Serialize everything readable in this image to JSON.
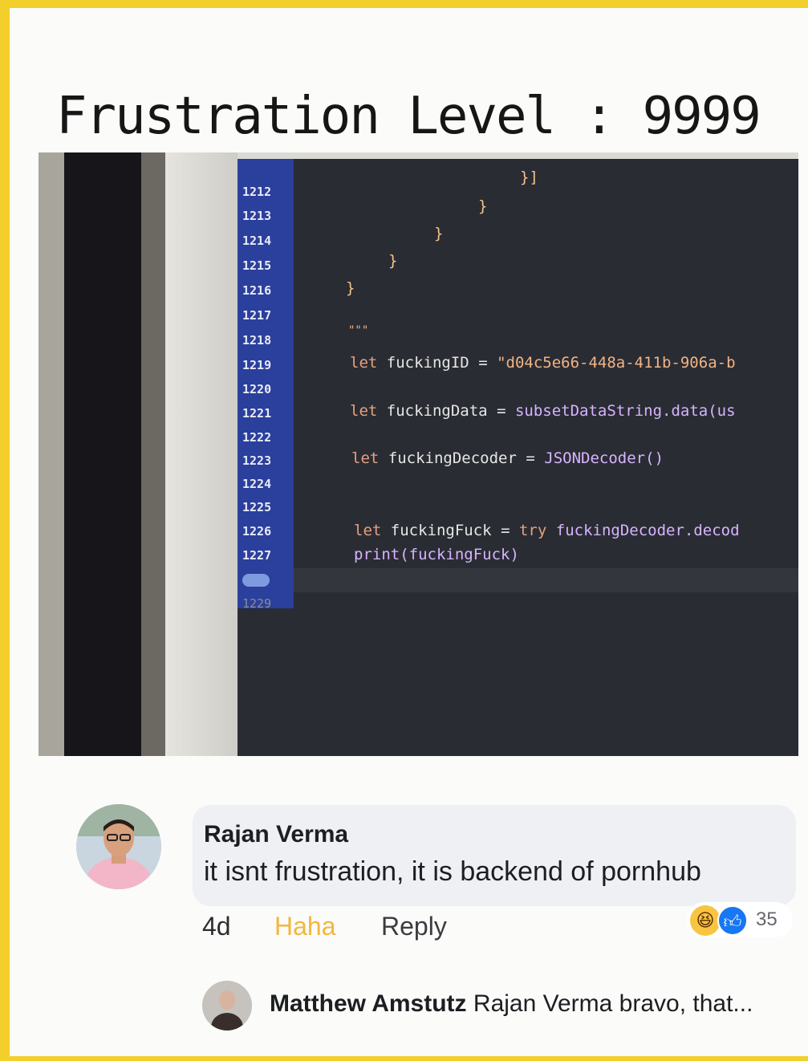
{
  "heading": "Frustration Level : 9999",
  "code_photo": {
    "line_numbers": [
      "1212",
      "1213",
      "1214",
      "1215",
      "1216",
      "1217",
      "1218",
      "1219",
      "1220",
      "1221",
      "1222",
      "1223",
      "1224",
      "1225",
      "1226",
      "1227",
      "1229"
    ],
    "braces": [
      "}]",
      "}",
      "}",
      "}",
      "}"
    ],
    "marker": "\"\"\"",
    "lines": {
      "l1219": {
        "kw": "let",
        "name": "fuckingID",
        "eq": "=",
        "value": "\"d04c5e66-448a-411b-906a-b"
      },
      "l1221": {
        "kw": "let",
        "name": "fuckingData",
        "eq": "=",
        "value": "subsetDataString.data(us"
      },
      "l1223": {
        "kw": "let",
        "name": "fuckingDecoder",
        "eq": "=",
        "value": "JSONDecoder()"
      },
      "l1226": {
        "kw": "let",
        "name": "fuckingFuck",
        "eq": "=",
        "try": "try",
        "value": "fuckingDecoder.decod"
      },
      "l1227": {
        "text": "print(fuckingFuck)"
      }
    }
  },
  "comment": {
    "author": "Rajan Verma",
    "text": "it isnt frustration, it is backend of pornhub",
    "time": "4d",
    "haha_label": "Haha",
    "reply_label": "Reply",
    "reaction_count": "35",
    "colors": {
      "haha": "#f7b928",
      "link": "#65676b"
    }
  },
  "reply": {
    "author": "Matthew Amstutz",
    "text": "Rajan Verma bravo, that..."
  }
}
